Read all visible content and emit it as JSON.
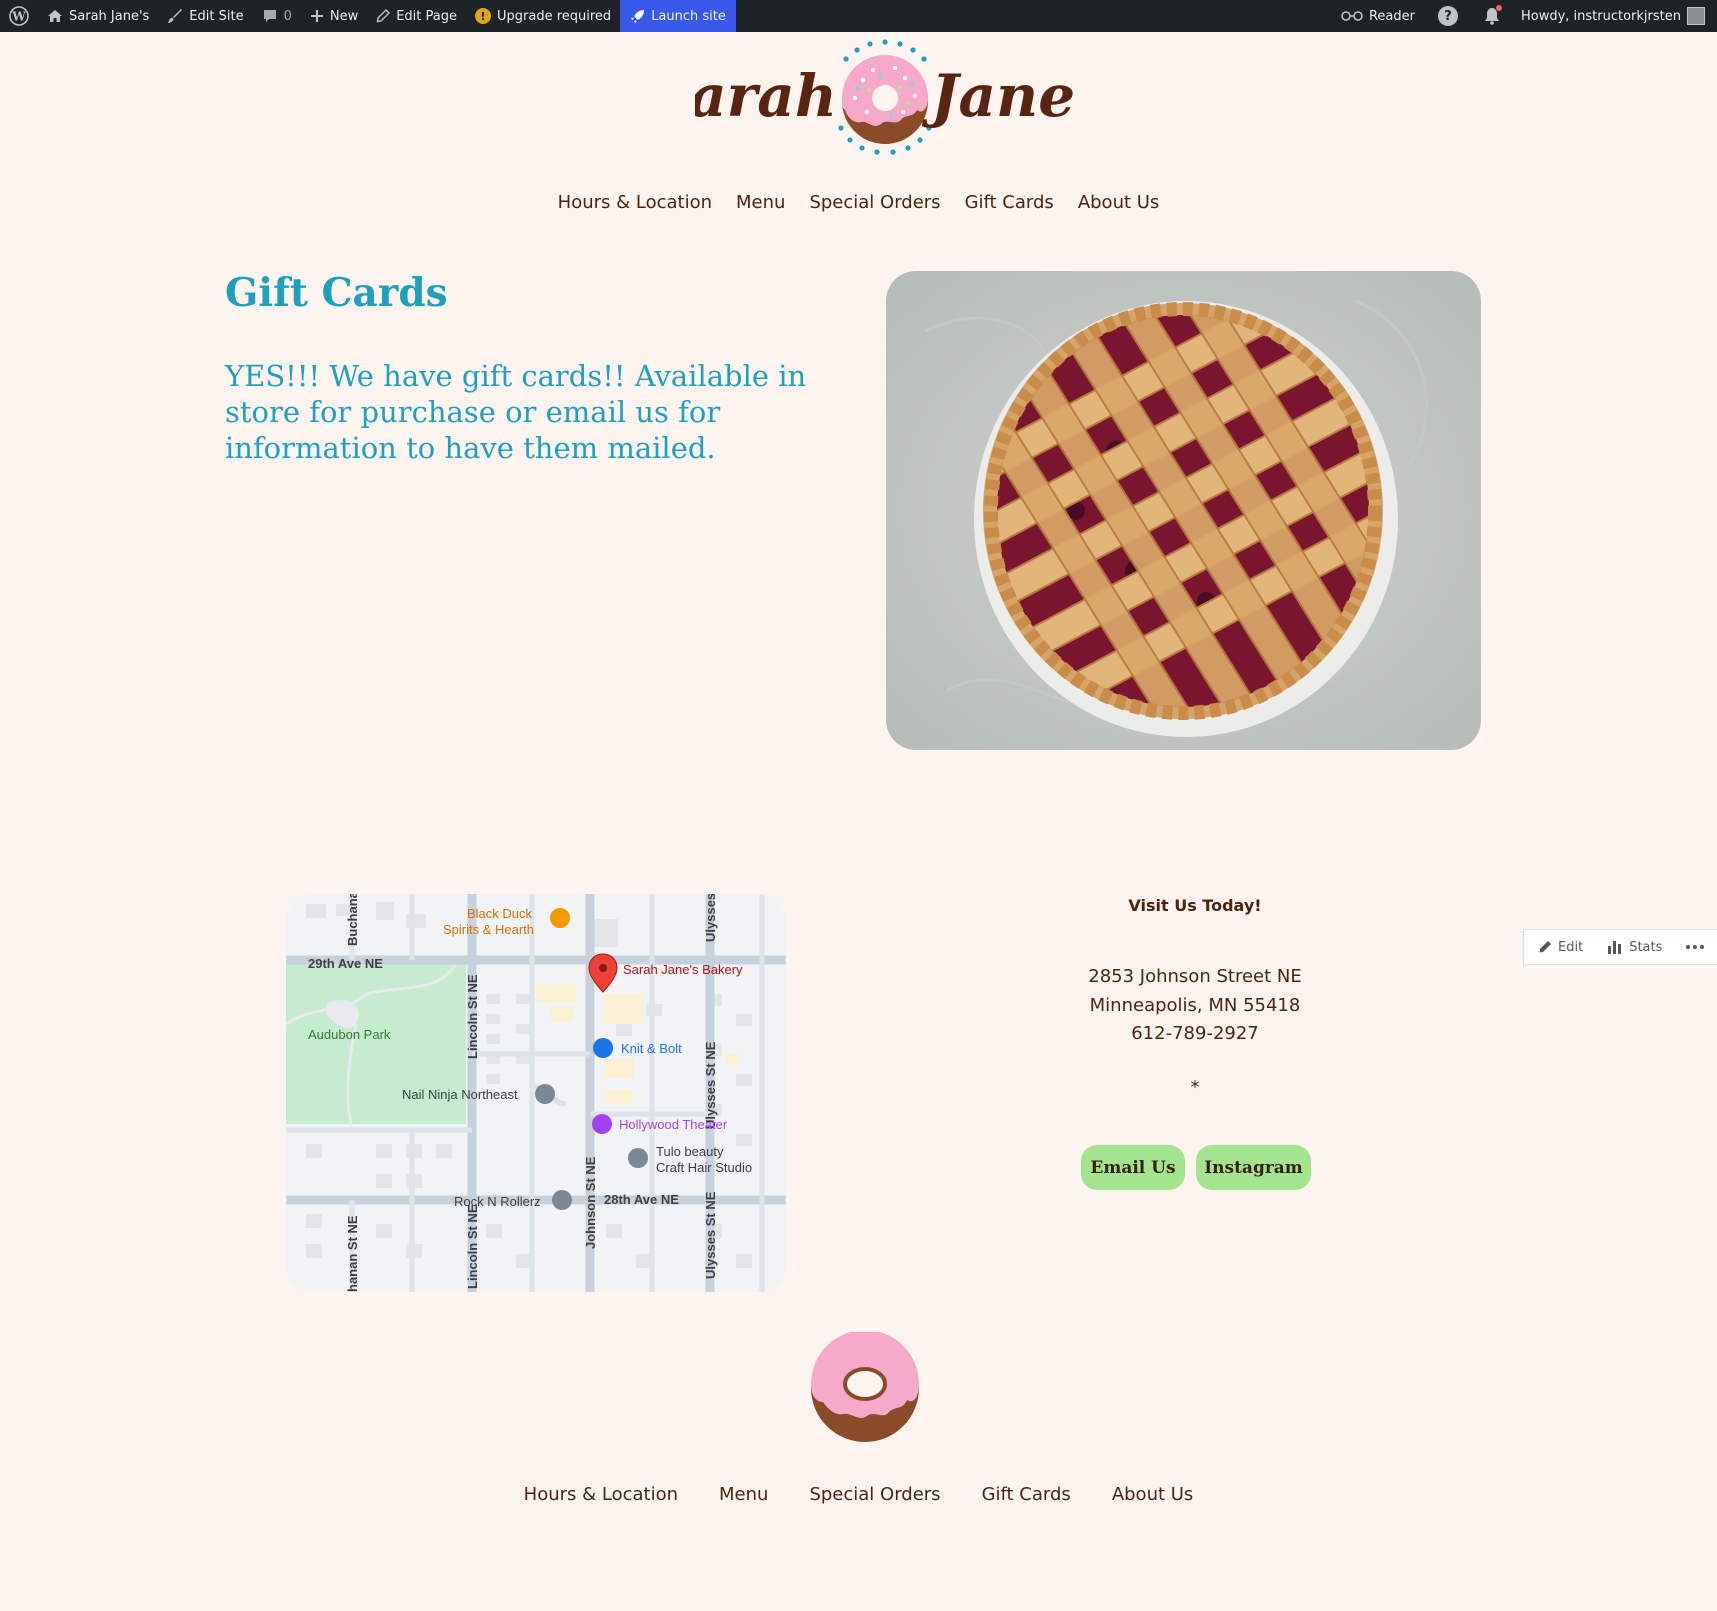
{
  "adminbar": {
    "site_name": "Sarah Jane's",
    "edit_site": "Edit Site",
    "comments_count": "0",
    "new": "New",
    "edit_page": "Edit Page",
    "upgrade": "Upgrade required",
    "launch": "Launch site",
    "reader": "Reader",
    "howdy": "Howdy, instructorkjrsten"
  },
  "header": {
    "logo_left": "Sarah",
    "logo_right": "Jane's",
    "nav": [
      "Hours & Location",
      "Menu",
      "Special Orders",
      "Gift Cards",
      "About Us"
    ]
  },
  "main": {
    "title": "Gift Cards",
    "intro": "YES!!! We have gift cards!! Available in store for purchase or email us for information to have them mailed."
  },
  "map": {
    "streets": {
      "ave29": "29th Ave NE",
      "ave28": "28th Ave NE",
      "lincoln": "Lincoln St NE",
      "lincoln2": "Lincoln St NE",
      "johnson": "Johnson St NE",
      "ulysses": "Ulysses St NE",
      "ulysses2": "Ulysses St NE",
      "ulysses_top": "Ulysses",
      "buchanan_top": "Buchana",
      "buchanan_bottom": "hanan St NE"
    },
    "places": {
      "park": "Audubon Park",
      "bakery": "Sarah Jane's Bakery",
      "black_duck_1": "Black Duck",
      "black_duck_2": "Spirits & Hearth",
      "knit": "Knit & Bolt",
      "nail": "Nail Ninja Northeast",
      "theater": "Hollywood Theater",
      "tulo_1": "Tulo beauty",
      "tulo_2": "Craft Hair Studio",
      "rock": "Rock N Rollerz"
    }
  },
  "visit": {
    "title": "Visit Us Today!",
    "address_line1": "2853 Johnson Street NE",
    "address_line2": "Minneapolis, MN 55418",
    "phone": "612-789-2927",
    "separator": "*",
    "email_button": "Email Us",
    "instagram_button": "Instagram"
  },
  "floatbar": {
    "edit": "Edit",
    "stats": "Stats"
  },
  "footer": {
    "nav": [
      "Hours & Location",
      "Menu",
      "Special Orders",
      "Gift Cards",
      "About Us"
    ]
  },
  "colors": {
    "background": "#fdf4ef",
    "accent_blue": "#1ea0bf",
    "brown": "#4a2410",
    "button_green": "#a3e58f",
    "admin_bar": "#1d2327",
    "launch_blue": "#3858e9",
    "donut_pink": "#f6a9c9"
  }
}
